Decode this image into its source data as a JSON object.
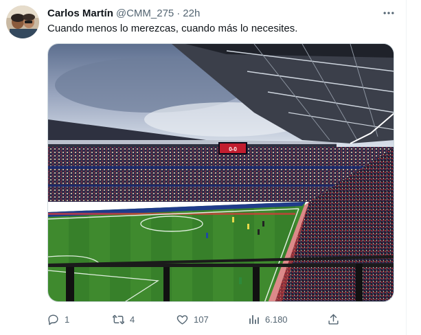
{
  "tweet": {
    "author_name": "Carlos Martín",
    "author_handle": "@CMM_275",
    "separator": "·",
    "time": "22h",
    "text": "Cuando menos lo merezcas, cuando más lo necesites.",
    "media": {
      "scoreboard": "0-0"
    },
    "actions": {
      "reply_count": "1",
      "retweet_count": "4",
      "like_count": "107",
      "views_count": "6.180"
    }
  },
  "colors": {
    "text_primary": "#0f1419",
    "text_secondary": "#536471",
    "border": "#cfd9de"
  },
  "icons": {
    "more": "more-dots-icon",
    "reply": "reply-icon",
    "retweet": "retweet-icon",
    "like": "heart-icon",
    "views": "views-icon",
    "share": "share-icon"
  }
}
